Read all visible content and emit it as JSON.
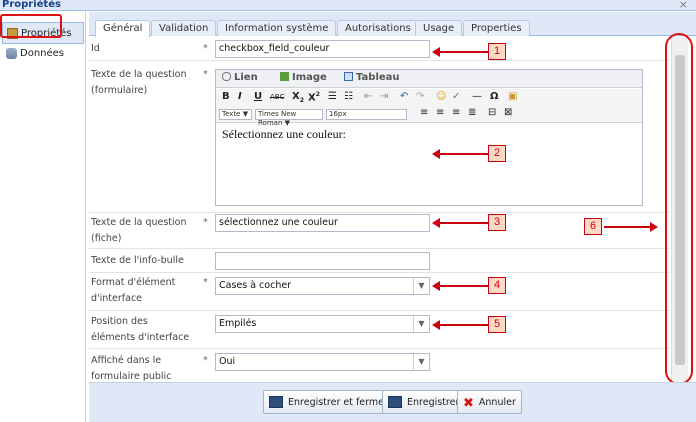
{
  "window": {
    "title": "Propriétés",
    "close_glyph": "×"
  },
  "nav": {
    "items": [
      {
        "label": "Propriétés",
        "icon": "properties-icon"
      },
      {
        "label": "Données",
        "icon": "database-icon"
      }
    ]
  },
  "tabs": [
    "Général",
    "Validation",
    "Information système",
    "Autorisations",
    "Usage",
    "Properties"
  ],
  "form": {
    "required_marker": "*",
    "id": {
      "label": "Id",
      "value": "checkbox_field_couleur"
    },
    "question_form": {
      "label_line1": "Texte de la question",
      "label_line2": "(formulaire)",
      "editor_tabs": [
        "Lien",
        "Image",
        "Tableau"
      ],
      "style_value": "Texte",
      "font_value": "Times New Roman",
      "size_value": "16px",
      "content": "Sélectionnez une couleur:"
    },
    "question_sheet": {
      "label_line1": "Texte de la question",
      "label_line2": "(fiche)",
      "value": "sélectionnez une couleur"
    },
    "tooltip": {
      "label": "Texte de l'info-bulle",
      "value": ""
    },
    "format": {
      "label_line1": "Format d'élément",
      "label_line2": "d'interface",
      "value": "Cases à cocher"
    },
    "position": {
      "label_line1": "Position des",
      "label_line2": "éléments d'interface",
      "value": "Empilés"
    },
    "public": {
      "label_line1": "Affiché dans le",
      "label_line2": "formulaire public",
      "value": "Oui"
    }
  },
  "footer": {
    "save_close": "Enregistrer et fermer",
    "save": "Enregistrer",
    "cancel": "Annuler"
  },
  "callouts": [
    "1",
    "2",
    "3",
    "4",
    "5",
    "6"
  ],
  "colors": {
    "annotation": "#cc0011",
    "callout_fill": "#fbd9c5",
    "panel": "#dfe8f6"
  }
}
